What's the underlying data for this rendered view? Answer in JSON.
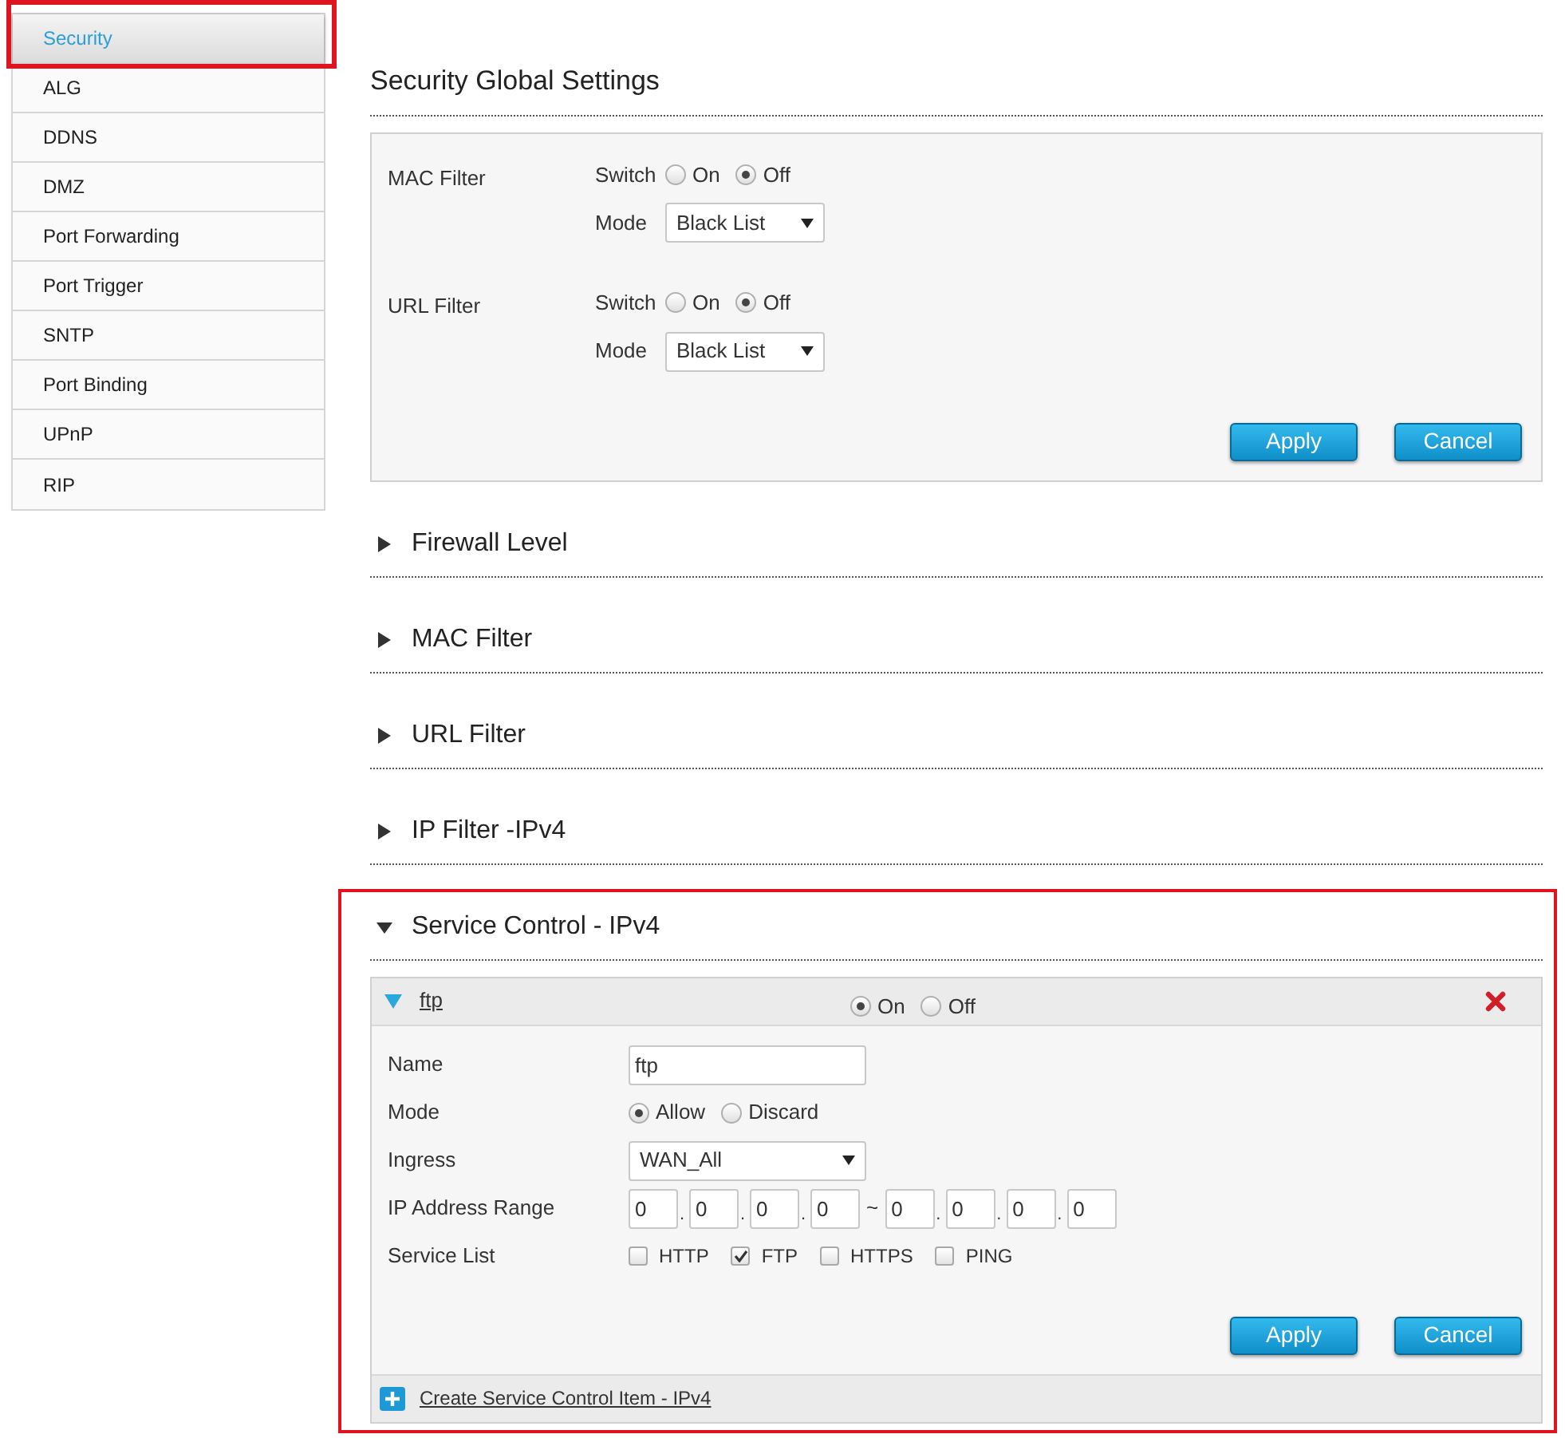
{
  "sidebar": {
    "items": [
      {
        "label": "Security",
        "selected": true
      },
      {
        "label": "ALG",
        "selected": false
      },
      {
        "label": "DDNS",
        "selected": false
      },
      {
        "label": "DMZ",
        "selected": false
      },
      {
        "label": "Port Forwarding",
        "selected": false
      },
      {
        "label": "Port Trigger",
        "selected": false
      },
      {
        "label": "SNTP",
        "selected": false
      },
      {
        "label": "Port Binding",
        "selected": false
      },
      {
        "label": "UPnP",
        "selected": false
      },
      {
        "label": "RIP",
        "selected": false
      }
    ]
  },
  "global_settings": {
    "title": "Security Global Settings",
    "filters": [
      {
        "label": "MAC Filter",
        "switch_label": "Switch",
        "options": [
          {
            "label": "On",
            "selected": false
          },
          {
            "label": "Off",
            "selected": true
          }
        ],
        "mode_label": "Mode",
        "mode_value": "Black List"
      },
      {
        "label": "URL Filter",
        "switch_label": "Switch",
        "options": [
          {
            "label": "On",
            "selected": false
          },
          {
            "label": "Off",
            "selected": true
          }
        ],
        "mode_label": "Mode",
        "mode_value": "Black List"
      }
    ],
    "buttons": [
      "Apply",
      "Cancel"
    ]
  },
  "sections": [
    {
      "title": "Firewall Level",
      "expanded": false
    },
    {
      "title": "MAC Filter",
      "expanded": false
    },
    {
      "title": "URL Filter",
      "expanded": false
    },
    {
      "title": "IP Filter -IPv4",
      "expanded": false
    },
    {
      "title": "Service Control - IPv4",
      "expanded": true
    }
  ],
  "service_item": {
    "name_link": "ftp",
    "expanded": true,
    "options": [
      {
        "label": "On",
        "selected": true
      },
      {
        "label": "Off",
        "selected": false
      }
    ],
    "fields": {
      "name_label": "Name",
      "name_value": "ftp",
      "mode_label": "Mode",
      "mode_options": [
        {
          "label": "Allow",
          "selected": true
        },
        {
          "label": "Discard",
          "selected": false
        }
      ],
      "ingress_label": "Ingress",
      "ingress_value": "WAN_All",
      "ip_label": "IP Address Range",
      "ip_start": [
        "0",
        "0",
        "0",
        "0"
      ],
      "ip_end": [
        "0",
        "0",
        "0",
        "0"
      ],
      "octet_separator": ".",
      "separator": "~",
      "service_label": "Service List",
      "services": [
        {
          "label": "HTTP",
          "checked": false
        },
        {
          "label": "FTP",
          "checked": true
        },
        {
          "label": "HTTPS",
          "checked": false
        },
        {
          "label": "PING",
          "checked": false
        }
      ]
    },
    "buttons": [
      "Apply",
      "Cancel"
    ],
    "create_link": "Create Service Control Item - IPv4"
  }
}
